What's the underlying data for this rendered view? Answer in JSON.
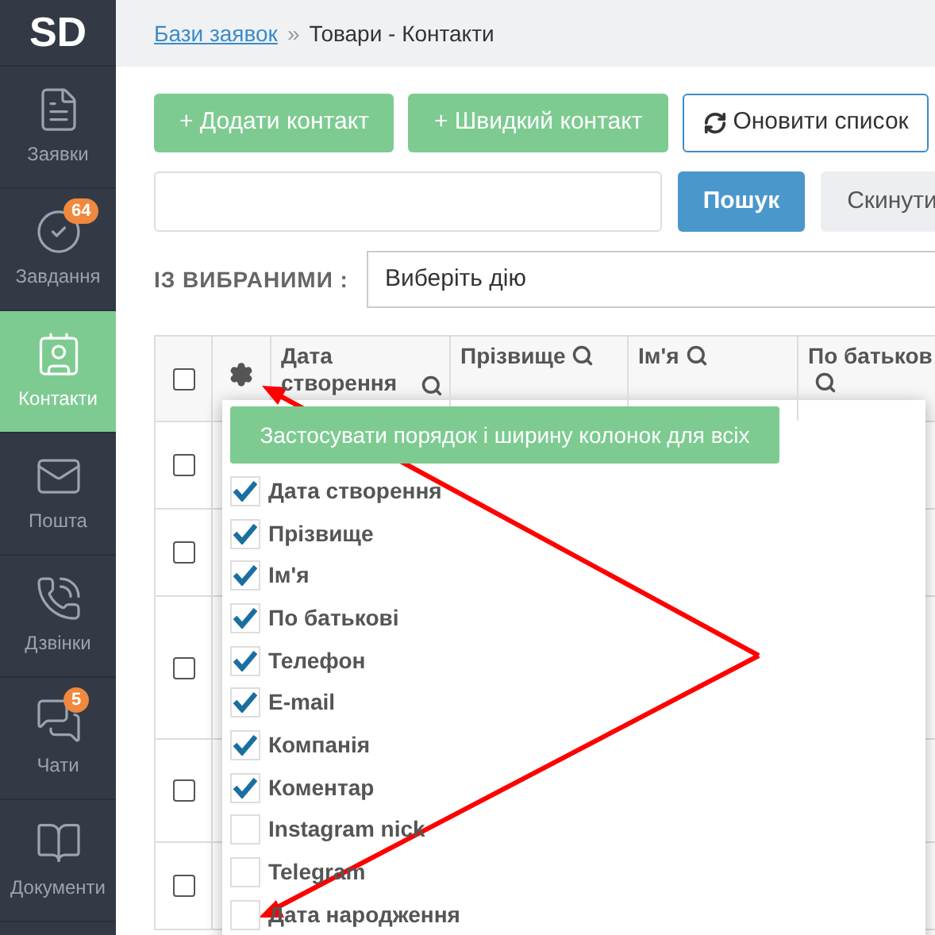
{
  "sidebar": {
    "logo": "SD",
    "items": [
      {
        "label": "Заявки",
        "selected": false
      },
      {
        "label": "Завдання",
        "selected": false,
        "badge": "64"
      },
      {
        "label": "Контакти",
        "selected": true
      },
      {
        "label": "Пошта",
        "selected": false
      },
      {
        "label": "Дзвінки",
        "selected": false
      },
      {
        "label": "Чати",
        "selected": false,
        "badge": "5"
      },
      {
        "label": "Документи",
        "selected": false
      }
    ]
  },
  "breadcrumb": {
    "link": "Бази заявок",
    "separator": "»",
    "current": "Товари - Контакти"
  },
  "toolbar": {
    "buttons": [
      {
        "label": "+ Додати контакт",
        "kind": "green"
      },
      {
        "label": "+ Швидкий контакт",
        "kind": "green"
      },
      {
        "label": "Оновити список",
        "kind": "outline"
      }
    ]
  },
  "search": {
    "search_button": "Пошук",
    "reset_button": "Скинути"
  },
  "bulk": {
    "label": "ІЗ ВИБРАНИМИ :",
    "select": "Виберіть дію"
  },
  "table": {
    "select_all": {
      "checked": false
    },
    "columns": [
      {
        "label": "Дата створення"
      },
      {
        "label": "Прізвище"
      },
      {
        "label": "Ім'я"
      },
      {
        "label": "По батьков"
      }
    ],
    "rows": [
      {
        "checked": false
      },
      {
        "checked": false
      },
      {
        "checked": false
      },
      {
        "checked": false
      },
      {
        "checked": false
      }
    ]
  },
  "column_settings": {
    "apply_button": "Застосувати порядок і ширину колонок для всіх",
    "items": [
      {
        "label": "Дата створення",
        "checked": true
      },
      {
        "label": "Прізвище",
        "checked": true
      },
      {
        "label": "Ім'я",
        "checked": true
      },
      {
        "label": "По батькові",
        "checked": true
      },
      {
        "label": "Телефон",
        "checked": true
      },
      {
        "label": "E-mail",
        "checked": true
      },
      {
        "label": "Компанія",
        "checked": true
      },
      {
        "label": "Коментар",
        "checked": true
      },
      {
        "label": "Instagram nick",
        "checked": false
      },
      {
        "label": "Telegram",
        "checked": false
      },
      {
        "label": "Дата народження",
        "checked": false
      }
    ]
  }
}
